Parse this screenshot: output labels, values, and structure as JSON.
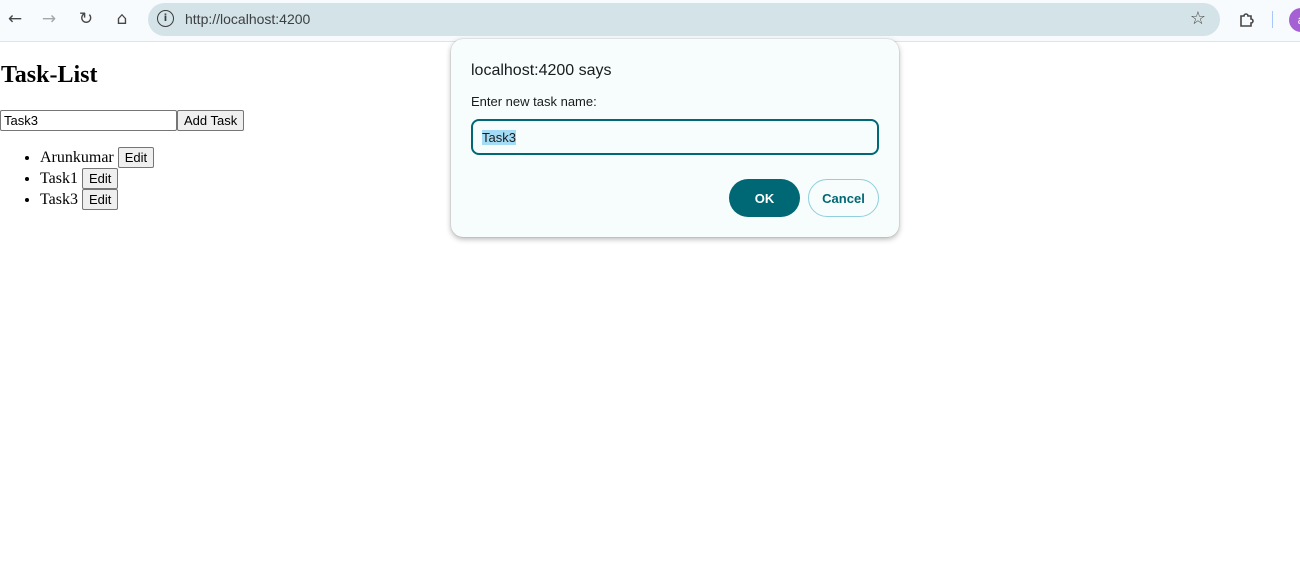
{
  "browser": {
    "url": "http://localhost:4200",
    "avatar_letter": "a",
    "icons": {
      "back": "back-arrow-icon",
      "forward": "forward-arrow-icon",
      "reload": "reload-icon",
      "home": "home-icon",
      "site_info": "info-icon",
      "bookmark": "star-icon",
      "extensions": "puzzle-icon"
    }
  },
  "page": {
    "title": "Task-List",
    "new_task_value": "Task3",
    "add_button_label": "Add Task",
    "tasks": [
      {
        "name": "Arunkumar",
        "edit_label": "Edit"
      },
      {
        "name": "Task1",
        "edit_label": "Edit"
      },
      {
        "name": "Task3",
        "edit_label": "Edit"
      }
    ]
  },
  "dialog": {
    "title": "localhost:4200 says",
    "message": "Enter new task name:",
    "input_value": "Task3",
    "ok_label": "OK",
    "cancel_label": "Cancel",
    "accent_color": "#006874"
  }
}
